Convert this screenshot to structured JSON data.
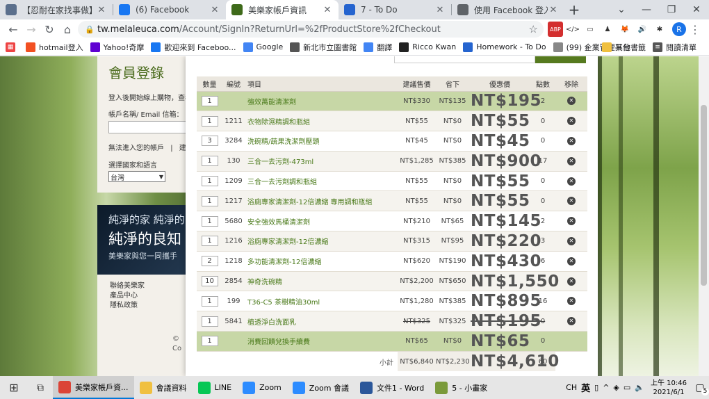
{
  "browser": {
    "tabs": [
      {
        "title": "【忍耐在家找事做】有之...",
        "icon": "tab-favicon-photo",
        "color": "#5b6f8c",
        "active": false
      },
      {
        "title": "(6) Facebook",
        "icon": "facebook-icon",
        "color": "#1877f2",
        "active": false
      },
      {
        "title": "美樂家帳戶資訊",
        "icon": "melaleuca-icon",
        "color": "#3e6a1a",
        "active": true
      },
      {
        "title": "7 - To Do",
        "icon": "todo-check-icon",
        "color": "#2564cf",
        "active": false
      },
      {
        "title": "使用 Facebook 登入 - Zo...",
        "icon": "globe-icon",
        "color": "#5f6368",
        "active": false
      }
    ],
    "newtab": "+",
    "url_host": "tw.melaleuca.com",
    "url_path": "/Account/SignIn?ReturnUrl=%2fProductStore%2fCheckout",
    "profile_initial": "R",
    "extensions": [
      "ABP",
      "</>",
      "▭",
      "♟",
      "🦊",
      "🔊",
      "✱"
    ],
    "bookmarks": [
      {
        "label": "hotmail登入",
        "icon": "windows-icon",
        "color": "#f25022"
      },
      {
        "label": "Yahoo!奇摩",
        "icon": "yahoo-icon",
        "color": "#6001d2"
      },
      {
        "label": "歡迎來到 Faceboo...",
        "icon": "facebook-icon",
        "color": "#1877f2"
      },
      {
        "label": "Google",
        "icon": "google-icon",
        "color": "#4285f4"
      },
      {
        "label": "新北市立圖書館",
        "icon": "library-icon",
        "color": "#555555"
      },
      {
        "label": "翻譯",
        "icon": "translate-icon",
        "color": "#4285f4"
      },
      {
        "label": "Ricco Kwan",
        "icon": "ricco-icon",
        "color": "#222222"
      },
      {
        "label": "Homework - To Do",
        "icon": "todo-check-icon",
        "color": "#2564cf"
      },
      {
        "label": "(99) 企業管理平台",
        "icon": "doc-icon",
        "color": "#888888"
      }
    ],
    "bookmarks_more": "»",
    "other_bookmarks": "其他書籤",
    "reading_list": "閱讀清單"
  },
  "login": {
    "title": "會員登錄",
    "desc": "登入後開始線上購物，查看",
    "username_label": "帳戶名稱/ Email 信箱：",
    "cannot_access": "無法進入您的帳戶",
    "divider": "|",
    "create": "建立",
    "country_label": "選擇國家和語言",
    "country_value": "台灣"
  },
  "banner": {
    "line1": "純淨的家  純淨的",
    "line2": "純淨的良知",
    "line3": "美樂家與您一同攜手"
  },
  "footer": {
    "links": [
      "聯絡美樂家",
      "產品中心",
      "隱私政策"
    ],
    "copyright": "© Co"
  },
  "cart": {
    "headers": [
      "數量",
      "編號",
      "項目",
      "建議售價",
      "省下",
      "優惠價",
      "點數",
      "移除"
    ],
    "rows": [
      {
        "qty": "1",
        "code": "",
        "item": "強效萬能清潔劑",
        "retail": "NT$330",
        "save": "NT$135",
        "price": "NT$195",
        "points": "2",
        "style": "green",
        "strike": false
      },
      {
        "qty": "1",
        "code": "1211",
        "item": "衣物除濕精調和瓶組",
        "retail": "NT$55",
        "save": "NT$0",
        "price": "NT$55",
        "points": "0",
        "style": "alt",
        "strike": false
      },
      {
        "qty": "3",
        "code": "3284",
        "item": "洗碗精/蔬果洗潔劑壓頭",
        "retail": "NT$45",
        "save": "NT$0",
        "price": "NT$45",
        "points": "0",
        "style": "plain",
        "strike": false
      },
      {
        "qty": "1",
        "code": "130",
        "item": "三合一去污劑-473ml",
        "retail": "NT$1,285",
        "save": "NT$385",
        "price": "NT$900",
        "points": "17",
        "style": "alt",
        "strike": false
      },
      {
        "qty": "1",
        "code": "1209",
        "item": "三合一去污劑調和瓶組",
        "retail": "NT$55",
        "save": "NT$0",
        "price": "NT$55",
        "points": "0",
        "style": "plain",
        "strike": false
      },
      {
        "qty": "1",
        "code": "1217",
        "item": "浴廁專家清潔劑-12倍濃縮 專用調和瓶組",
        "retail": "NT$55",
        "save": "NT$0",
        "price": "NT$55",
        "points": "0",
        "style": "alt",
        "strike": false
      },
      {
        "qty": "1",
        "code": "5680",
        "item": "安全強效馬桶清潔劑",
        "retail": "NT$210",
        "save": "NT$65",
        "price": "NT$145",
        "points": "2",
        "style": "plain",
        "strike": false
      },
      {
        "qty": "1",
        "code": "1216",
        "item": "浴廁專家清潔劑-12倍濃縮",
        "retail": "NT$315",
        "save": "NT$95",
        "price": "NT$220",
        "points": "3",
        "style": "alt",
        "strike": false
      },
      {
        "qty": "2",
        "code": "1218",
        "item": "多功能清潔劑-12倍濃縮",
        "retail": "NT$620",
        "save": "NT$190",
        "price": "NT$430",
        "points": "6",
        "style": "plain",
        "strike": false
      },
      {
        "qty": "10",
        "code": "2854",
        "item": "神奇洗碗精",
        "retail": "NT$2,200",
        "save": "NT$650",
        "price": "NT$1,550",
        "points": "",
        "style": "alt",
        "strike": false
      },
      {
        "qty": "1",
        "code": "199",
        "item": "T36-C5 茶樹精油30ml",
        "retail": "NT$1,280",
        "save": "NT$385",
        "price": "NT$895",
        "points": "16",
        "style": "plain",
        "strike": false
      },
      {
        "qty": "1",
        "code": "5841",
        "item": "植透淨白洗面乳",
        "retail": "NT$325",
        "save": "NT$325",
        "price": "NT$195",
        "points": "0",
        "style": "alt",
        "strike": true
      },
      {
        "qty": "1",
        "code": "",
        "item": "消費回饋兌換手續費",
        "retail": "NT$65",
        "save": "NT$0",
        "price": "NT$65",
        "points": "0",
        "style": "green",
        "strike": false
      }
    ],
    "subtotal_label": "小計",
    "subtotal_retail": "NT$6,840",
    "subtotal_save": "NT$2,230",
    "subtotal_price": "NT$4,610",
    "subtotal_points": "60"
  },
  "taskbar": {
    "apps": [
      {
        "label": "美樂家帳戶資...",
        "icon": "chrome-icon",
        "color": "#db4437",
        "active": true
      },
      {
        "label": "會議資料",
        "icon": "folder-icon",
        "color": "#f0c040",
        "active": false
      },
      {
        "label": "LINE",
        "icon": "line-icon",
        "color": "#06c755",
        "active": false
      },
      {
        "label": "Zoom",
        "icon": "zoom-icon",
        "color": "#2d8cff",
        "active": false
      },
      {
        "label": "Zoom 會議",
        "icon": "zoom-icon",
        "color": "#2d8cff",
        "active": false
      },
      {
        "label": "文件1 - Word",
        "icon": "word-icon",
        "color": "#2b579a",
        "active": false
      },
      {
        "label": "5 - 小畫家",
        "icon": "paint-icon",
        "color": "#7a9a3a",
        "active": false
      }
    ],
    "lang": "CH",
    "ime": "英",
    "time": "上午 10:46",
    "date": "2021/6/1",
    "notifications": "5"
  }
}
